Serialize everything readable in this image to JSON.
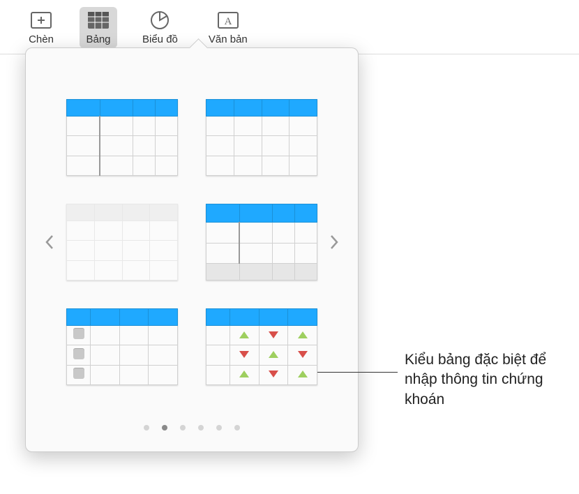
{
  "toolbar": {
    "items": [
      {
        "label": "Chèn",
        "icon": "insert"
      },
      {
        "label": "Bảng",
        "icon": "table"
      },
      {
        "label": "Biểu đồ",
        "icon": "chart"
      },
      {
        "label": "Văn bản",
        "icon": "text"
      }
    ]
  },
  "pager": {
    "count": 6,
    "active_index": 1
  },
  "callout": {
    "text": "Kiểu bảng đặc biệt để nhập thông tin chứng khoán"
  },
  "colors": {
    "accent": "#1fa9ff",
    "up": "#9ecf5f",
    "down": "#d84f4a"
  }
}
